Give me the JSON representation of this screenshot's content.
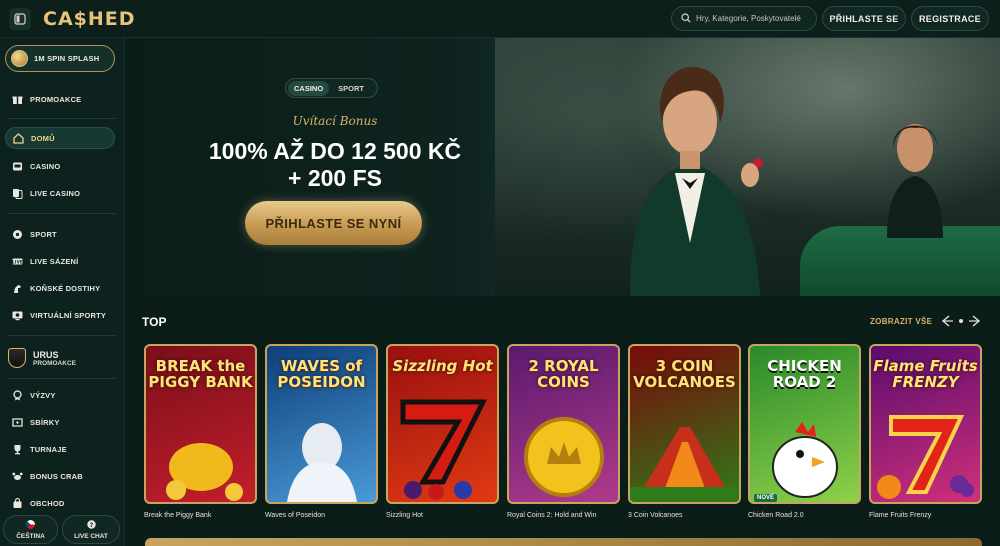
{
  "header": {
    "logo": "CA$HED",
    "search_placeholder": "Hry, Kategorie, Poskytovatelé",
    "login_label": "PŘIHLASTE SE",
    "register_label": "REGISTRACE"
  },
  "sidebar": {
    "promo_pill": "1M SPIN SPLASH",
    "items": [
      {
        "label": "PROMOAKCE",
        "icon": "gift-icon"
      },
      {
        "label": "DOMŮ",
        "icon": "home-icon",
        "active": true
      },
      {
        "label": "CASINO",
        "icon": "slot-icon"
      },
      {
        "label": "LIVE CASINO",
        "icon": "cards-icon"
      },
      {
        "label": "SPORT",
        "icon": "ball-icon"
      },
      {
        "label": "LIVE SÁZENÍ",
        "icon": "live-icon"
      },
      {
        "label": "KOŇSKÉ DOSTIHY",
        "icon": "horse-icon"
      },
      {
        "label": "VIRTUÁLNÍ SPORTY",
        "icon": "virtual-icon"
      },
      {
        "label": "VÝZVY",
        "icon": "badge-icon"
      },
      {
        "label": "SBÍRKY",
        "icon": "collection-icon"
      },
      {
        "label": "TURNAJE",
        "icon": "trophy-icon"
      },
      {
        "label": "BONUS CRAB",
        "icon": "crab-icon"
      },
      {
        "label": "OBCHOD",
        "icon": "bag-icon"
      }
    ],
    "urus": {
      "title": "URUS",
      "subtitle": "PROMOAKCE"
    },
    "language_label": "ČEŠTINA",
    "live_chat_label": "LIVE CHAT"
  },
  "hero": {
    "tabs": [
      "CASINO",
      "SPORT"
    ],
    "active_tab": "CASINO",
    "subtitle": "Uvítací Bonus",
    "headline_line1": "100% AŽ DO 12 500 KČ",
    "headline_line2": "+ 200 FS",
    "cta_label": "PŘIHLASTE SE NYNÍ"
  },
  "games_section": {
    "title": "TOP",
    "view_all_label": "ZOBRAZIT VŠE",
    "games": [
      {
        "name": "Break the Piggy Bank",
        "art_title": "BREAK the PIGGY BANK",
        "colors": [
          "#7a0f1a",
          "#c21f2b"
        ]
      },
      {
        "name": "Waves of Poseidon",
        "art_title": "WAVES of POSEIDON",
        "colors": [
          "#0e3f7a",
          "#4a9ad6"
        ]
      },
      {
        "name": "Sizzling Hot",
        "art_title": "Sizzling Hot",
        "colors": [
          "#9a1010",
          "#e03a12"
        ]
      },
      {
        "name": "Royal Coins 2: Hold and Win",
        "art_title": "2 ROYAL COINS",
        "colors": [
          "#5a1a6e",
          "#b03a8a"
        ]
      },
      {
        "name": "3 Coin Volcanoes",
        "art_title": "3 COIN VOLCANOES",
        "colors": [
          "#7a0a0a",
          "#2f7a1a"
        ]
      },
      {
        "name": "Chicken Road 2.0",
        "art_title": "CHICKEN ROAD 2",
        "colors": [
          "#2a8a2a",
          "#8ed14a"
        ],
        "badge": "NOVÉ"
      },
      {
        "name": "Flame Fruits Frenzy",
        "art_title": "Flame Fruits FRENZY",
        "colors": [
          "#5a0c6e",
          "#d0307a"
        ]
      }
    ]
  }
}
